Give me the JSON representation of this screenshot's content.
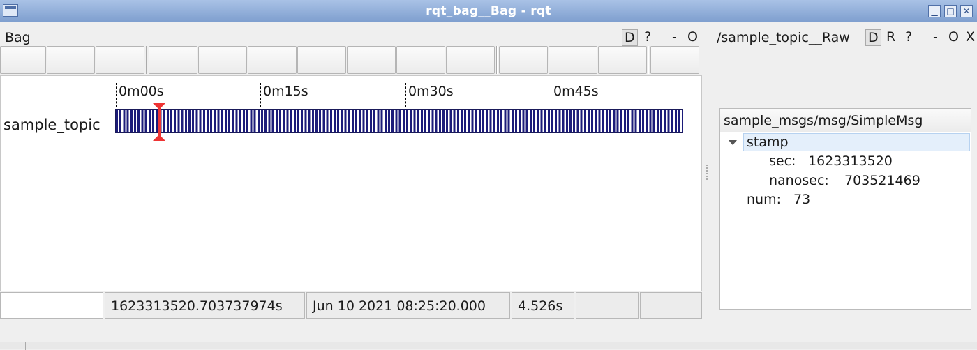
{
  "window": {
    "title": "rqt_bag__Bag - rqt"
  },
  "left_dock": {
    "title": "Bag",
    "buttons": {
      "d": "D",
      "help": "?",
      "minimize": "-",
      "float": "O"
    }
  },
  "timeline": {
    "ticks": [
      "0m00s",
      "0m15s",
      "0m30s",
      "0m45s"
    ],
    "topics": [
      "sample_topic"
    ]
  },
  "status_bar": {
    "timestamp": "1623313520.703737974s",
    "date": "Jun 10 2021 08:25:20.000",
    "elapsed": "4.526s"
  },
  "right_dock": {
    "title": "/sample_topic__Raw",
    "buttons": {
      "d": "D",
      "r": "R",
      "help": "?",
      "minimize": "-",
      "float": "O",
      "close": "X"
    },
    "tree": {
      "header": "sample_msgs/msg/SimpleMsg",
      "stamp_label": "stamp",
      "sec_label": "sec:",
      "sec_value": "1623313520",
      "nanosec_label": "nanosec:",
      "nanosec_value": "703521469",
      "num_label": "num:",
      "num_value": "73"
    }
  },
  "colors": {
    "bar": "#1c1c7a",
    "playhead": "#e33333",
    "titlebar": "#8fabd8"
  }
}
